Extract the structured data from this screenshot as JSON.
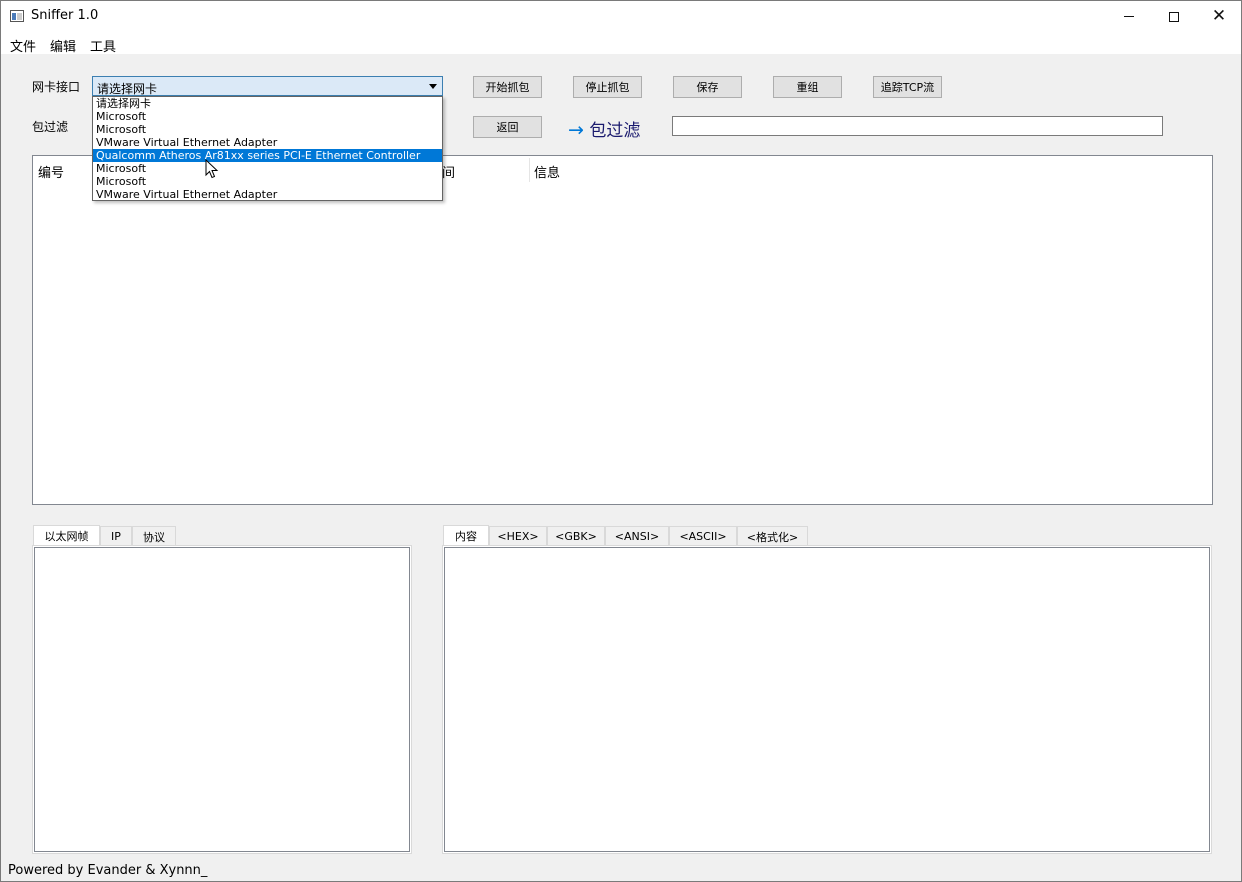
{
  "window": {
    "title": "Sniffer 1.0"
  },
  "menu": [
    "文件",
    "编辑",
    "工具"
  ],
  "controls": {
    "nic_label": "网卡接口",
    "filter_label": "包过滤",
    "nic_selected": "请选择网卡",
    "nic_options": [
      "请选择网卡",
      "Microsoft",
      "Microsoft",
      "VMware Virtual Ethernet Adapter",
      "Qualcomm Atheros Ar81xx series PCI-E Ethernet Controller",
      "Microsoft",
      "Microsoft",
      "VMware Virtual Ethernet Adapter"
    ],
    "highlighted_option_index": 4,
    "buttons": {
      "start": "开始抓包",
      "stop": "停止抓包",
      "save": "保存",
      "reassemble": "重组",
      "follow_tcp": "追踪TCP流",
      "back": "返回"
    },
    "filter_heading": "包过滤",
    "filter_value": ""
  },
  "packet_table": {
    "columns": [
      "编号",
      "间",
      "信息"
    ]
  },
  "left_tabs": [
    "以太网帧",
    "IP",
    "协议"
  ],
  "right_tabs": [
    "内容",
    "<HEX>",
    "<GBK>",
    "<ANSI>",
    "<ASCII>",
    "<格式化>"
  ],
  "status": "Powered by Evander & Xynnn_",
  "colors": {
    "accent": "#0078d7",
    "combo_bg": "#dbe9f7"
  }
}
